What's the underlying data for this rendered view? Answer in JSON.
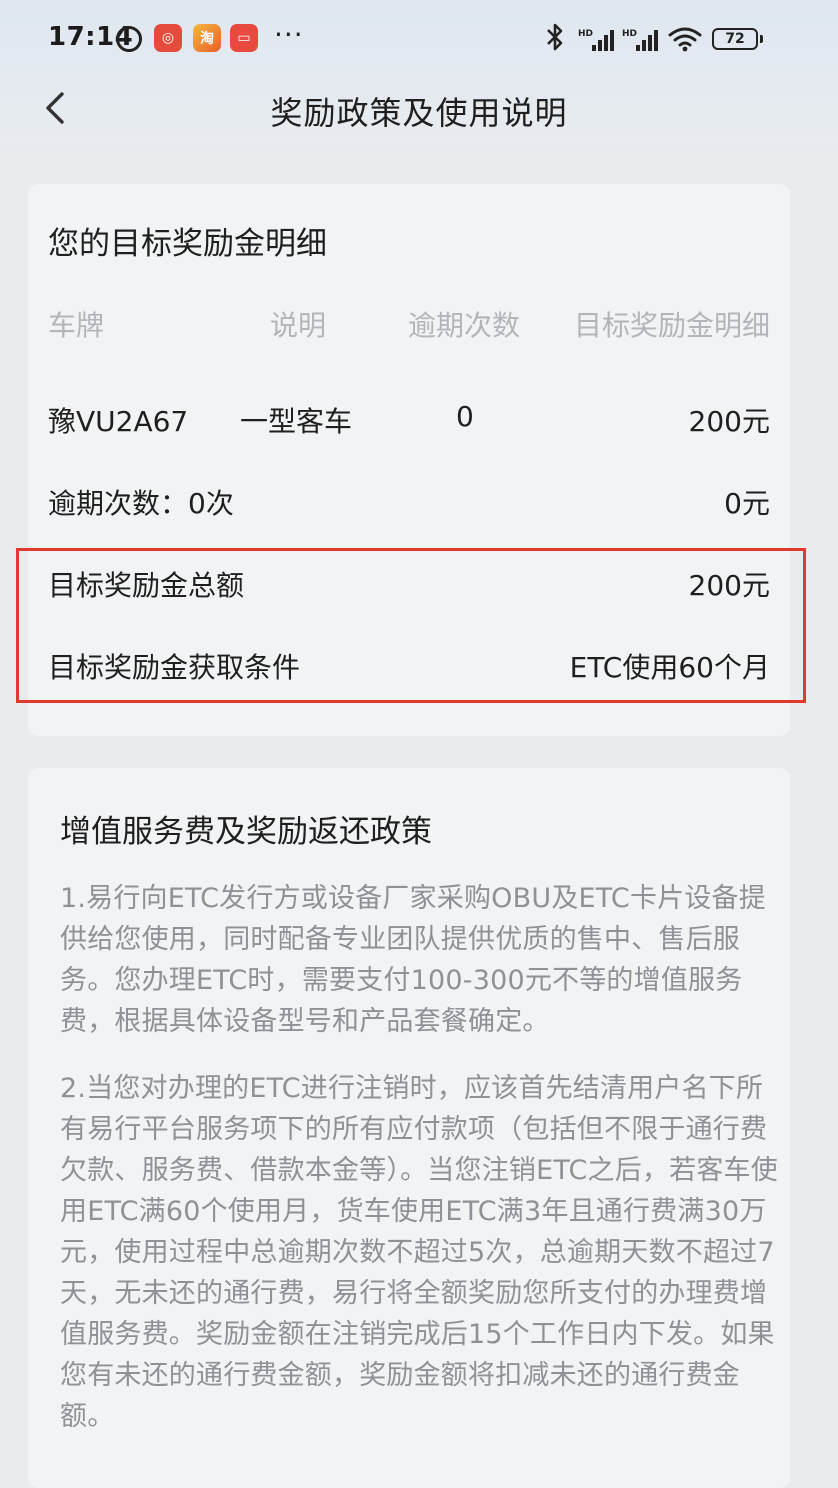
{
  "status_bar": {
    "time": "17:14",
    "more": "···",
    "battery": "72",
    "app_icons": [
      "alarm-icon",
      "netease-music-icon",
      "taobao-icon",
      "calendar-app-icon"
    ]
  },
  "nav": {
    "title": "奖励政策及使用说明"
  },
  "reward_card": {
    "title": "您的目标奖励金明细",
    "columns": [
      "车牌",
      "说明",
      "逾期次数",
      "目标奖励金明细"
    ],
    "vehicle_row": {
      "plate": "豫VU2A67",
      "desc": "一型客车",
      "overdue": "0",
      "amount": "200元"
    },
    "overdue_row": {
      "label": "逾期次数：0次",
      "amount": "0元"
    },
    "total_row": {
      "label": "目标奖励金总额",
      "amount": "200元"
    },
    "condition_row": {
      "label": "目标奖励金获取条件",
      "value": "ETC使用60个月"
    }
  },
  "policy_card": {
    "title": "增值服务费及奖励返还政策",
    "paragraphs": [
      "1.易行向ETC发行方或设备厂家采购OBU及ETC卡片设备提供给您使用，同时配备专业团队提供优质的售中、售后服务。您办理ETC时，需要支付100-300元不等的增值服务费，根据具体设备型号和产品套餐确定。",
      "2.当您对办理的ETC进行注销时，应该首先结清用户名下所有易行平台服务项下的所有应付款项（包括但不限于通行费欠款、服务费、借款本金等）。当您注销ETC之后，若客车使用ETC满60个使用月，货车使用ETC满3年且通行费满30万元，使用过程中总逾期次数不超过5次，总逾期天数不超过7天，无未还的通行费，易行将全额奖励您所支付的办理费增值服务费。奖励金额在注销完成后15个工作日内下发。如果您有未还的通行费金额，奖励金额将扣减未还的通行费金额。"
    ]
  },
  "colors": {
    "highlight_border": "#e03a30",
    "muted_text": "#8e9196",
    "header_text": "#b2b5ba"
  }
}
